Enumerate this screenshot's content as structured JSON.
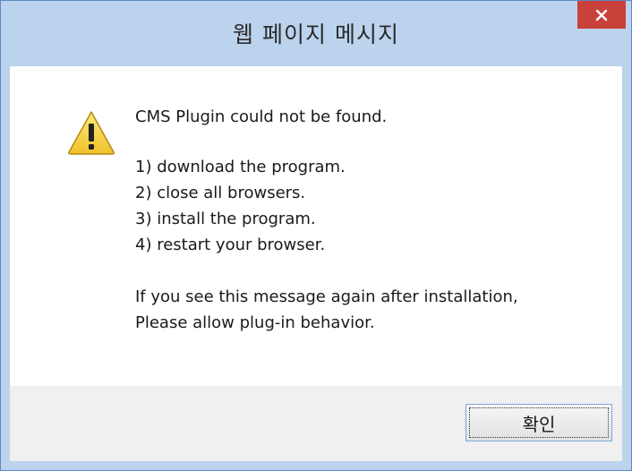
{
  "dialog": {
    "title": "웹 페이지 메시지",
    "close_icon": "close-icon",
    "warning_icon": "warning-icon",
    "headline": "CMS Plugin could not be found.",
    "steps": [
      "1) download the program.",
      "2) close all browsers.",
      "3) install the program.",
      "4) restart your browser."
    ],
    "note_lines": [
      "If you see this message again after installation,",
      "Please allow plug-in behavior."
    ],
    "ok_label": "확인"
  },
  "colors": {
    "titlebar": "#bcd3ee",
    "border": "#5b88c4",
    "close_button": "#c8413a",
    "footer": "#f0f0f0",
    "warning_fill": "#f7d23a"
  }
}
